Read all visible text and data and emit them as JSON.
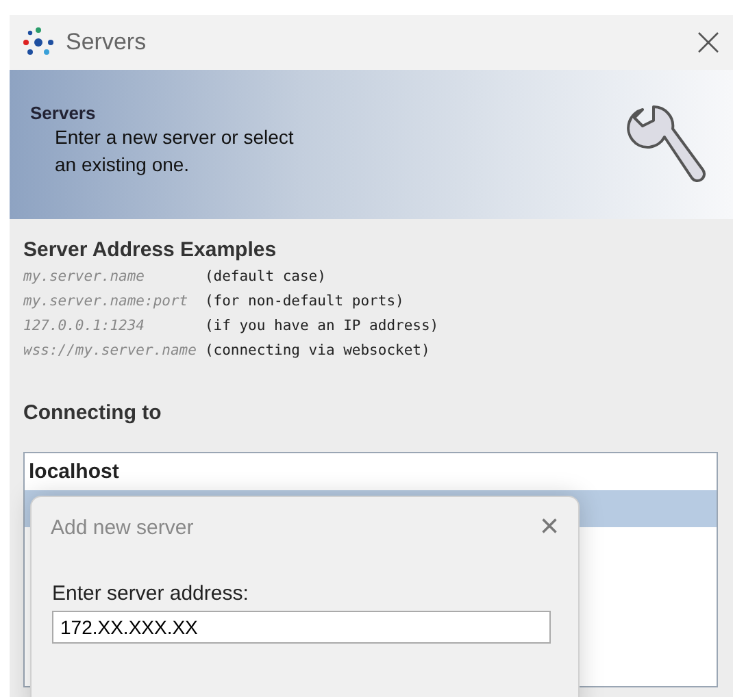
{
  "window": {
    "title": "Servers"
  },
  "banner": {
    "title": "Servers",
    "text": "Enter a new server or select an existing one."
  },
  "examples": {
    "heading": "Server Address Examples",
    "rows": [
      {
        "address": "my.server.name",
        "note": "(default case)"
      },
      {
        "address": "my.server.name:port",
        "note": "(for non-default ports)"
      },
      {
        "address": "127.0.0.1:1234",
        "note": "(if you have an IP address)"
      },
      {
        "address": "wss://my.server.name",
        "note": "(connecting via websocket)"
      }
    ]
  },
  "connecting": {
    "heading": "Connecting to",
    "servers": [
      {
        "label": "localhost",
        "selected": false
      },
      {
        "selected": true
      }
    ]
  },
  "dialog": {
    "title": "Add new server",
    "close": "×",
    "field_label": "Enter server address:",
    "value": "172.XX.XXX.XX"
  }
}
